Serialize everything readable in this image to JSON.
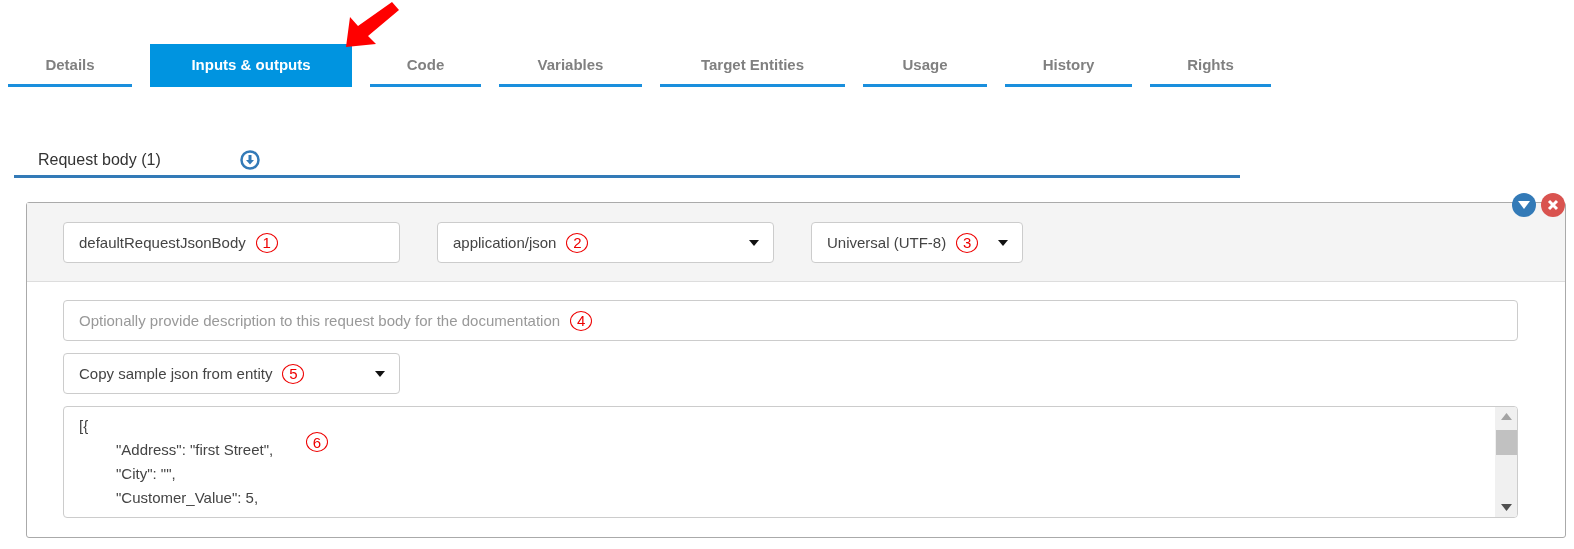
{
  "tabs": [
    {
      "label": "Details",
      "selected": false
    },
    {
      "label": "Inputs & outputs",
      "selected": true
    },
    {
      "label": "Code",
      "selected": false
    },
    {
      "label": "Variables",
      "selected": false
    },
    {
      "label": "Target Entities",
      "selected": false
    },
    {
      "label": "Usage",
      "selected": false
    },
    {
      "label": "History",
      "selected": false
    },
    {
      "label": "Rights",
      "selected": false
    }
  ],
  "section": {
    "title": "Request body (1)"
  },
  "request_body": {
    "name_field": {
      "value": "defaultRequestJsonBody",
      "annotation": "1"
    },
    "content_type": {
      "value": "application/json",
      "annotation": "2"
    },
    "encoding": {
      "value": "Universal (UTF-8)",
      "annotation": "3"
    },
    "description": {
      "placeholder": "Optionally provide description to this request body for the documentation",
      "annotation": "4"
    },
    "sample_source": {
      "value": "Copy sample json from entity",
      "annotation": "5"
    },
    "body": {
      "annotation": "6",
      "lines": [
        {
          "text": "[{",
          "children": [
            {
              "text": "\"Address\": \"first Street\","
            },
            {
              "text": "\"City\": \"\","
            },
            {
              "text": "\"Customer_Value\": 5,"
            }
          ]
        }
      ]
    }
  }
}
